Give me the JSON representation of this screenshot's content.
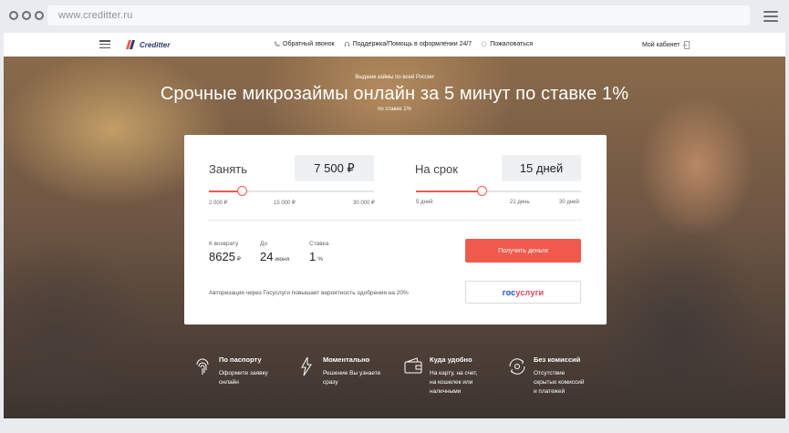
{
  "browser": {
    "url": "www.creditter.ru"
  },
  "navbar": {
    "logo_text": "Creditter",
    "links": [
      {
        "label": "Обратный звонок",
        "icon": "phone-icon"
      },
      {
        "label": "Поддержка/Помощь в оформлении 24/7",
        "icon": "headset-icon"
      },
      {
        "label": "Пожаловаться",
        "icon": "chat-bubble-icon"
      }
    ],
    "cabinet_label": "Мой кабинет"
  },
  "hero": {
    "pre_title": "Выдаем займы по всей России",
    "title": "Срочные микрозаймы онлайн за 5 минут по ставке 1%",
    "post_title": "по ставке 1%"
  },
  "calculator": {
    "amount": {
      "label": "Занять",
      "value": "7 500 ₽",
      "ticks": [
        "2 000 ₽",
        "15 000 ₽",
        "30 000 ₽"
      ],
      "fill_fraction": 0.2
    },
    "term": {
      "label": "На срок",
      "value": "15 дней",
      "ticks": [
        "5 дней",
        "21 день",
        "30 дней"
      ],
      "fill_fraction": 0.4
    },
    "stats": [
      {
        "label": "К возврату",
        "value": "8625",
        "unit": "₽"
      },
      {
        "label": "До",
        "value": "24",
        "unit": "июня"
      },
      {
        "label": "Ставка",
        "value": "1",
        "unit": "%"
      }
    ],
    "submit_label": "Получить деньги",
    "gosuslugi_note": "Авторизация через Госуслуги повышает вероятность одобрения на 20%",
    "gosuslugi_part1": "гос",
    "gosuslugi_part2": "услуги"
  },
  "features": [
    {
      "title": "По паспорту",
      "desc": [
        "Оформите заявку",
        "онлайн"
      ],
      "icon": "fingerprint-icon"
    },
    {
      "title": "Моментально",
      "desc": [
        "Решение Вы узнаете",
        "сразу"
      ],
      "icon": "lightning-icon"
    },
    {
      "title": "Куда удобно",
      "desc": [
        "На карту, на счет,",
        "на кошелек или",
        "наличными"
      ],
      "icon": "wallet-icon"
    },
    {
      "title": "Без комиссий",
      "desc": [
        "Отсутствие",
        "скрытых комиссий",
        "и платежей"
      ],
      "icon": "no-fee-icon"
    }
  ],
  "colors": {
    "accent": "#ef5a4c",
    "gos_blue": "#0d4cd3",
    "gos_red": "#ee3f58"
  }
}
